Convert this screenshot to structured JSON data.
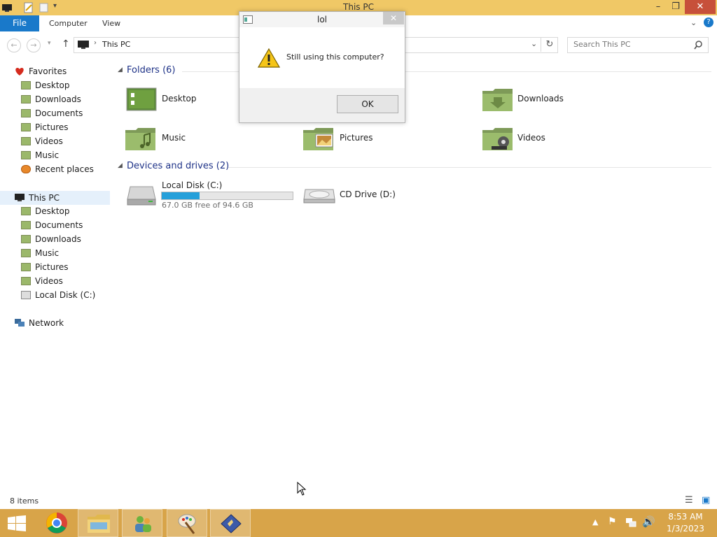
{
  "window": {
    "title": "This PC"
  },
  "ribbon": {
    "tabs": [
      "File",
      "Computer",
      "View"
    ]
  },
  "address": {
    "path": "This PC",
    "search_placeholder": "Search This PC"
  },
  "nav": {
    "favorites_label": "Favorites",
    "favorites": [
      "Desktop",
      "Downloads",
      "Documents",
      "Pictures",
      "Videos",
      "Music",
      "Recent places"
    ],
    "thispc_label": "This PC",
    "thispc": [
      "Desktop",
      "Documents",
      "Downloads",
      "Music",
      "Pictures",
      "Videos",
      "Local Disk (C:)"
    ],
    "network_label": "Network"
  },
  "content": {
    "folders_header": "Folders (6)",
    "folders": [
      "Desktop",
      "Downloads",
      "Music",
      "Pictures",
      "Videos"
    ],
    "devices_header": "Devices and drives (2)",
    "drive_c": {
      "name": "Local Disk (C:)",
      "free_text": "67.0 GB free of 94.6 GB",
      "used_fraction": 0.29
    },
    "drive_d": {
      "name": "CD Drive (D:)"
    }
  },
  "dialog": {
    "title": "lol",
    "message": "Still using this computer?",
    "ok_label": "OK"
  },
  "status": {
    "items_count": "8 items"
  },
  "taskbar": {
    "time": "8:53 AM",
    "date": "1/3/2023"
  },
  "colors": {
    "accent": "#1979ca",
    "titlebar": "#f0c866",
    "taskbar": "#d8a449",
    "drive_bar": "#26a0da"
  }
}
